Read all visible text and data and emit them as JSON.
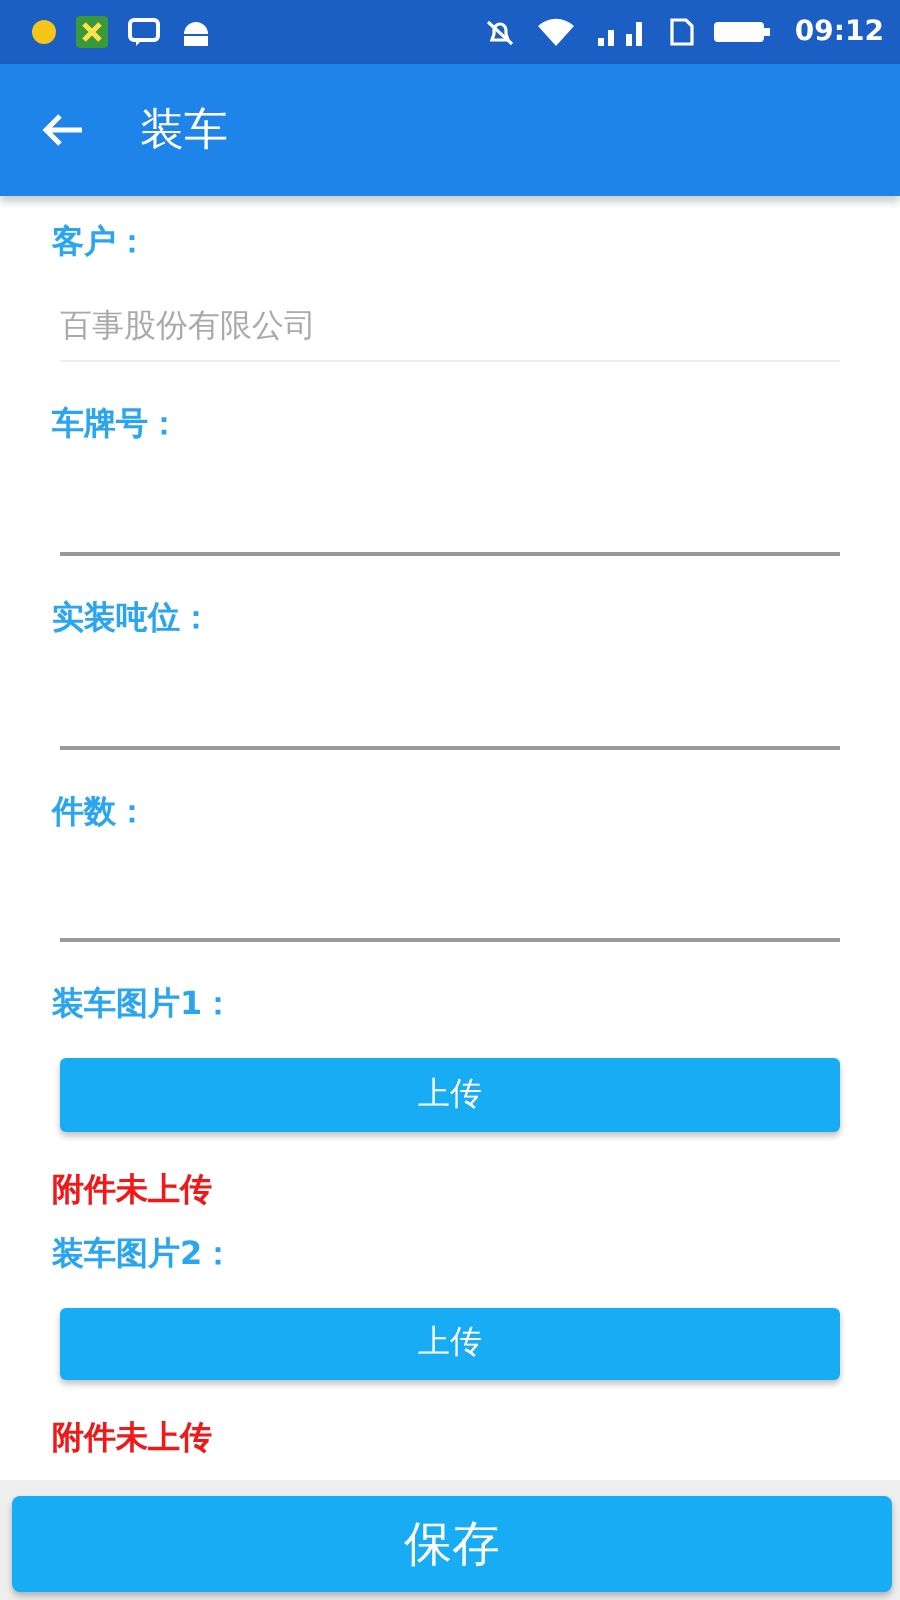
{
  "status_bar": {
    "time": "09:12"
  },
  "app_bar": {
    "title": "装车"
  },
  "fields": [
    {
      "kind": "readonly",
      "label": "客户：",
      "value": "百事股份有限公司"
    },
    {
      "kind": "input",
      "label": "车牌号："
    },
    {
      "kind": "input",
      "label": "实装吨位："
    },
    {
      "kind": "input",
      "label": "件数："
    },
    {
      "kind": "upload",
      "label": "装车图片1：",
      "button": "上传",
      "status": "附件未上传"
    },
    {
      "kind": "upload",
      "label": "装车图片2：",
      "button": "上传",
      "status": "附件未上传"
    }
  ],
  "save_button": "保存"
}
